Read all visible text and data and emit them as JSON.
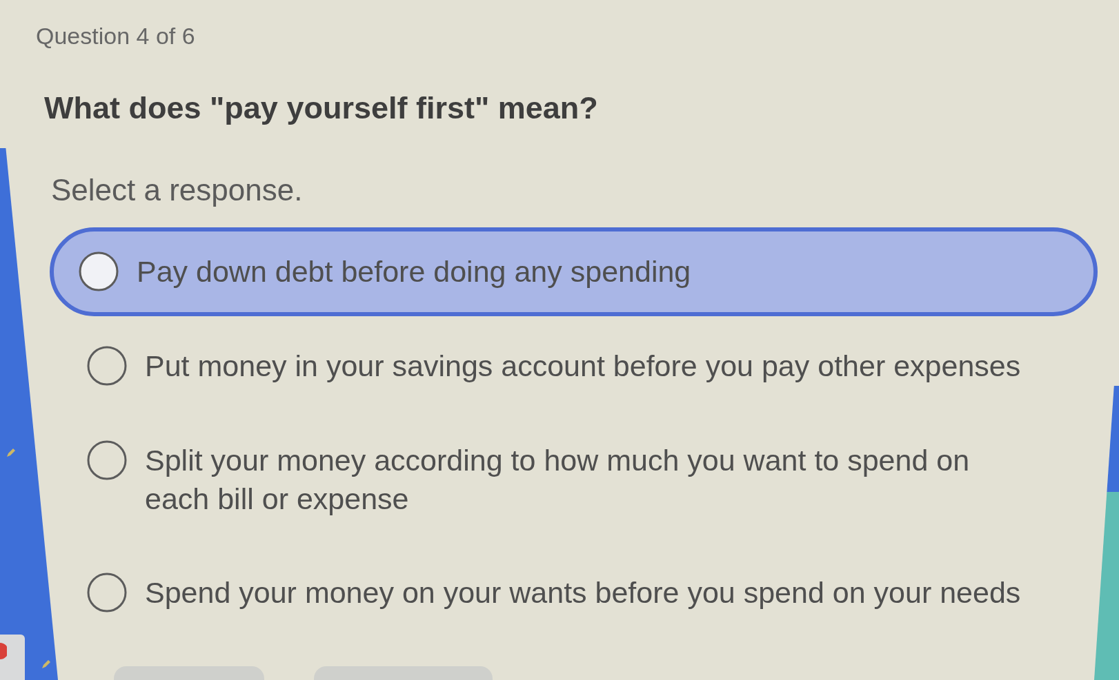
{
  "progress": "Question 4 of 6",
  "question": "What does \"pay yourself first\" mean?",
  "instruction": "Select a response.",
  "options": [
    {
      "label": "Pay down debt before doing any spending",
      "selected": false,
      "highlighted": true
    },
    {
      "label": "Put money in your savings account before you pay other expenses",
      "selected": false,
      "highlighted": false
    },
    {
      "label": "Split your money according to how much you want to spend on each bill or expense",
      "selected": false,
      "highlighted": false
    },
    {
      "label": "Spend your money on your wants before you spend on your needs",
      "selected": false,
      "highlighted": false
    }
  ]
}
